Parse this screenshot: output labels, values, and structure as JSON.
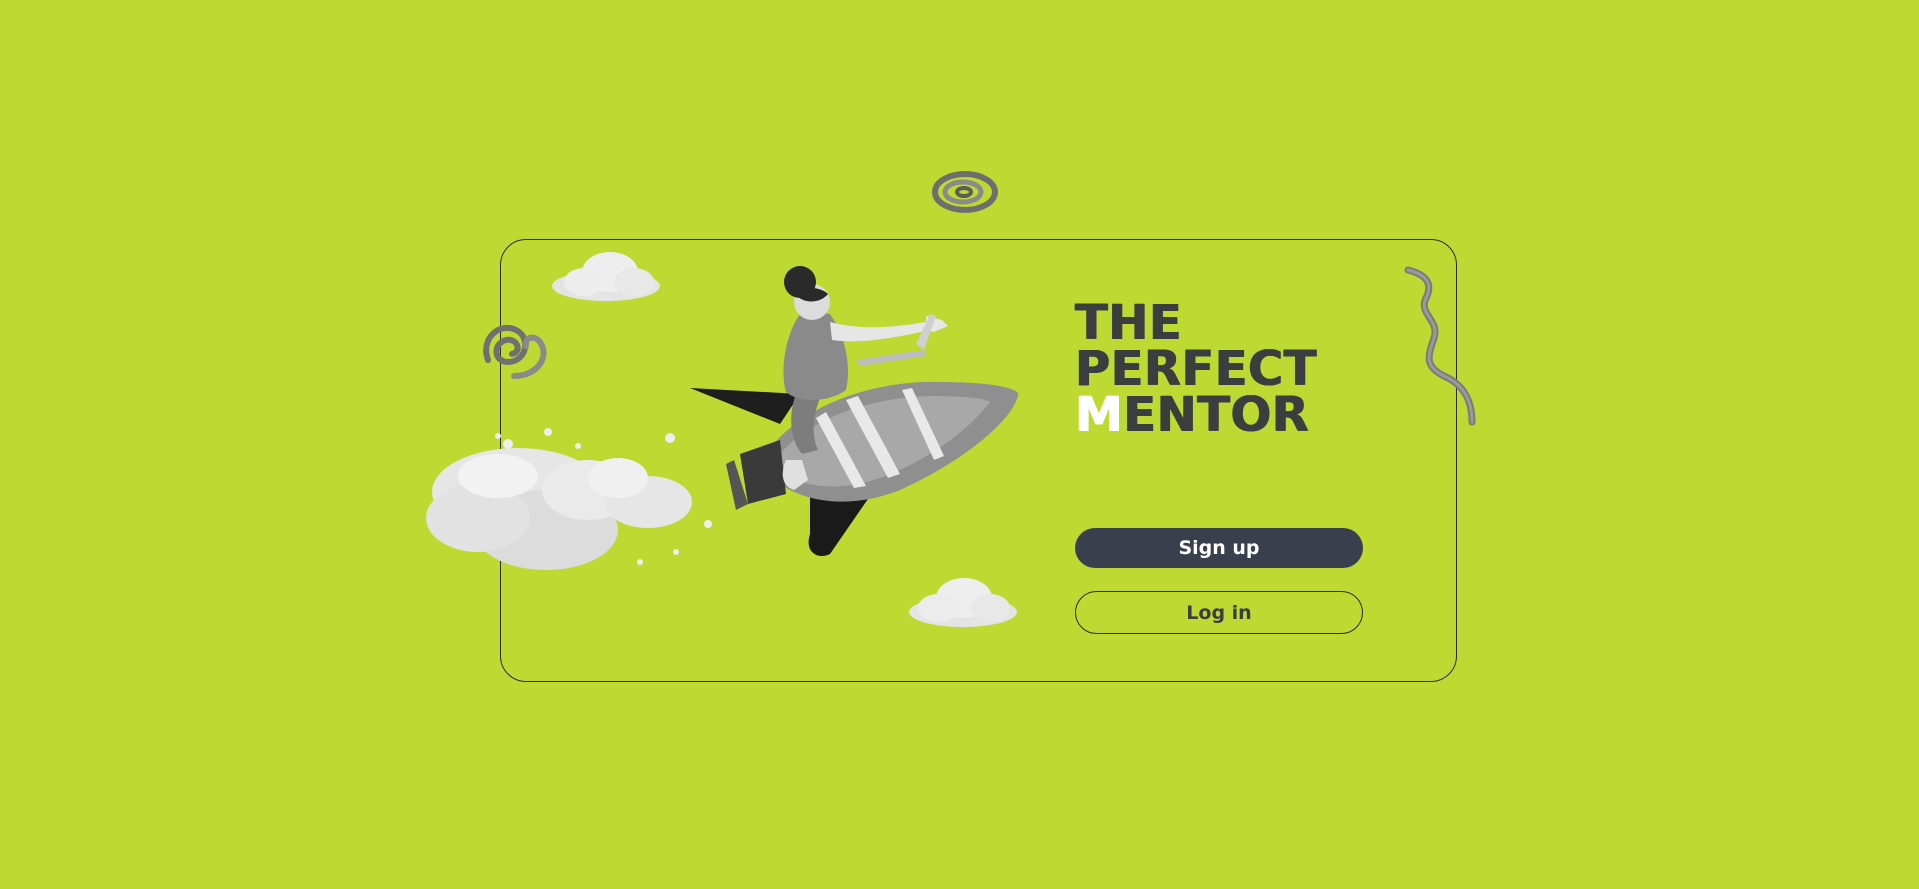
{
  "brand": {
    "title_line1": "THE",
    "title_line2": "PERFECT",
    "title_line3_accent": "M",
    "title_line3_rest": "ENTOR"
  },
  "actions": {
    "signup_label": "Sign up",
    "login_label": "Log in"
  },
  "theme": {
    "background": "#bed932",
    "dark": "#393f4d",
    "text": "#3b3d3f",
    "accent": "#ffffff"
  },
  "illustration": {
    "subject": "person-riding-rocket"
  }
}
